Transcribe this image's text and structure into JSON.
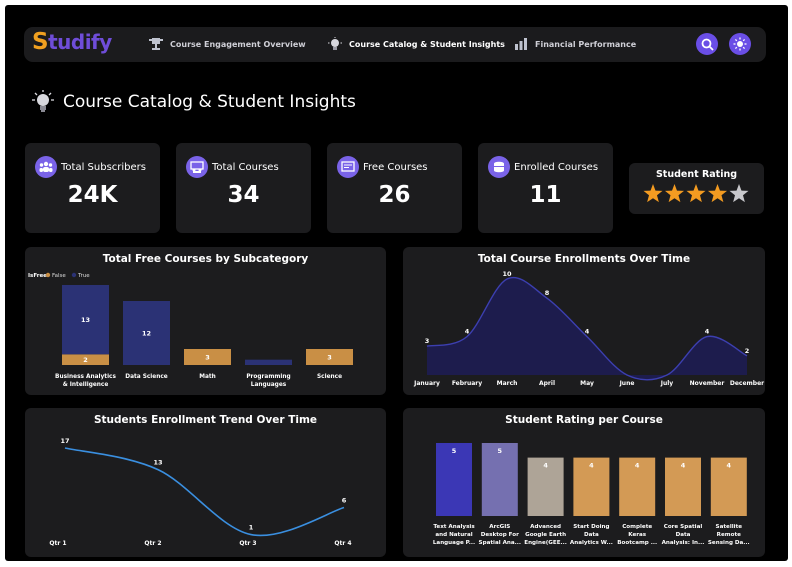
{
  "app": {
    "logo_first": "S",
    "logo_rest": "tudify"
  },
  "nav": [
    {
      "label": "Course Engagement Overview",
      "icon": "trophy-icon"
    },
    {
      "label": "Course Catalog & Student Insights",
      "icon": "lightbulb-icon"
    },
    {
      "label": "Financial Performance",
      "icon": "finance-icon"
    }
  ],
  "actions": {
    "search_icon": "search-icon",
    "theme_icon": "sun-icon"
  },
  "page_title": "Course Catalog & Student Insights",
  "kpis": [
    {
      "label": "Total Subscribers",
      "value": "24K",
      "icon": "people-icon"
    },
    {
      "label": "Total Courses",
      "value": "34",
      "icon": "classroom-icon"
    },
    {
      "label": "Free Courses",
      "value": "26",
      "icon": "certificate-icon"
    },
    {
      "label": "Enrolled Courses",
      "value": "11",
      "icon": "database-icon"
    }
  ],
  "rating": {
    "label": "Student Rating",
    "stars_filled": 4,
    "stars_total": 5
  },
  "colors": {
    "accent": "#6a4ee6",
    "navy": "#2b3275",
    "orange": "#c98f45",
    "line": "#3a8fe0"
  },
  "chart_data": [
    {
      "type": "bar",
      "title": "Total Free Courses by Subcategory",
      "legend_title": "IsFree",
      "legend": [
        "False",
        "True"
      ],
      "categories": [
        "Business Analytics & Intelligence",
        "Data Science",
        "Math",
        "Programming Languages",
        "Science"
      ],
      "series": [
        {
          "name": "False",
          "values": [
            2,
            0,
            3,
            0,
            3
          ]
        },
        {
          "name": "True",
          "values": [
            13,
            12,
            0,
            1,
            0
          ]
        }
      ],
      "stacked": true,
      "labels": [
        [
          "2",
          "13"
        ],
        [
          "",
          "12"
        ],
        [
          "3",
          ""
        ],
        [
          "",
          ""
        ],
        [
          "3",
          ""
        ]
      ]
    },
    {
      "type": "area",
      "title": "Total Course Enrollments Over Time",
      "categories": [
        "January",
        "February",
        "March",
        "April",
        "May",
        "June",
        "July",
        "November",
        "December"
      ],
      "values": [
        3,
        4,
        10,
        8,
        4,
        0,
        0,
        4,
        2
      ],
      "labels": [
        "3",
        "4",
        "10",
        "8",
        "4",
        "",
        "",
        "4",
        "2"
      ]
    },
    {
      "type": "line",
      "title": "Students Enrollment Trend Over Time",
      "categories": [
        "Qtr 1",
        "Qtr 2",
        "Qtr 3",
        "Qtr 4"
      ],
      "values": [
        17,
        13,
        1,
        6
      ]
    },
    {
      "type": "bar",
      "title": "Student Rating per Course",
      "categories": [
        [
          "Text Analysis",
          "and Natural",
          "Language P..."
        ],
        [
          "ArcGIS",
          "Desktop For",
          "Spatial Ana..."
        ],
        [
          "Advanced",
          "Google Earth",
          "Engine(GEE..."
        ],
        [
          "Start Doing",
          "Data",
          "Analytics W..."
        ],
        [
          "Complete",
          "Keras",
          "Bootcamp ..."
        ],
        [
          "Core Spatial",
          "Data",
          "Analysis: In..."
        ],
        [
          "Satellite",
          "Remote",
          "Sensing Da..."
        ]
      ],
      "values": [
        5,
        5,
        4,
        4,
        4,
        4,
        4
      ],
      "colors": [
        "#3b37b5",
        "#7570b0",
        "#aea497",
        "#d39a55",
        "#d39a55",
        "#d39a55",
        "#d39a55"
      ]
    }
  ]
}
